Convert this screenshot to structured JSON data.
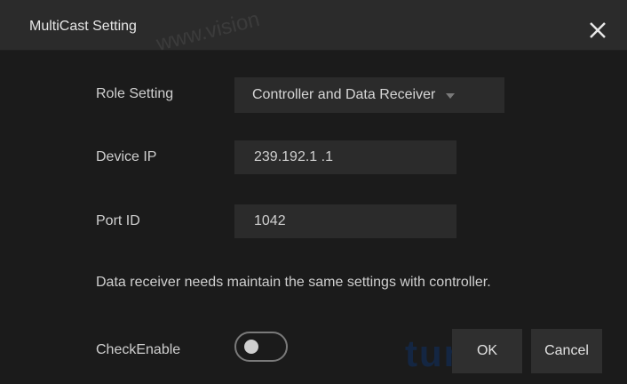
{
  "dialog": {
    "title": "MultiCast Setting",
    "watermark_text": "www.vision",
    "bottom_watermark": "tum"
  },
  "role_setting": {
    "label": "Role Setting",
    "value": "Controller and Data Receiver"
  },
  "device_ip": {
    "label": "Device IP",
    "value": "239.192.1 .1"
  },
  "port_id": {
    "label": "Port ID",
    "value": "1042"
  },
  "note": "Data receiver needs maintain the same settings with controller.",
  "check_enable": {
    "label": "CheckEnable",
    "state": "off"
  },
  "buttons": {
    "ok": "OK",
    "cancel": "Cancel"
  },
  "icons": {
    "close": "close-icon",
    "dropdown": "chevron-down-icon"
  },
  "colors": {
    "background": "#1b1b1b",
    "titlebar": "#2b2b2b",
    "field": "#2b2b2b",
    "button": "#2f2f2f",
    "text": "#cfcfcf"
  }
}
